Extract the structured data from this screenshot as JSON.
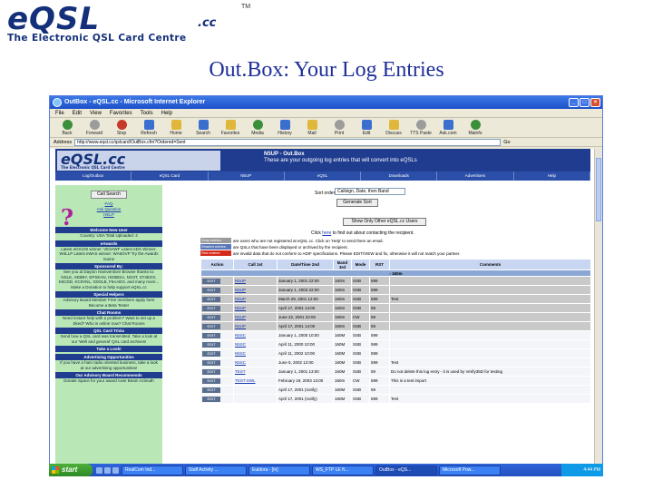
{
  "slide": {
    "logo_text": "eQSL",
    "logo_cc": ".cc",
    "logo_tm": "TM",
    "logo_subtitle": "The Electronic QSL Card Centre",
    "title": "Out.Box: Your Log Entries"
  },
  "browser": {
    "window_title": "OutBox - eQSL.cc - Microsoft Internet Explorer",
    "menu": [
      "File",
      "Edit",
      "View",
      "Favorites",
      "Tools",
      "Help"
    ],
    "toolbar": [
      "Back",
      "Forward",
      "Stop",
      "Refresh",
      "Home",
      "Search",
      "Favorites",
      "Media",
      "History",
      "Mail",
      "Print",
      "Edit",
      "Discuss",
      "TTS Paste",
      "Ask.com",
      "Mainfo"
    ],
    "address_label": "Address",
    "address": "http://www.eqsl.cc/qslcard/OutBox.cfm?Ordered=Sent",
    "go": "Go"
  },
  "site": {
    "logo": "eQSL.cc",
    "logo_sub": "The Electronic QSL Card Centre",
    "callsign": "N5UP - Out.Box",
    "subtitle": "These are your outgoing log entries that will convert into eQSLs",
    "nav": [
      "Log/Outbox",
      "eQSL Card",
      "N5UP",
      "eQSL",
      "Downloads",
      "Advertisers",
      "Help"
    ]
  },
  "sidebar": {
    "search_button": "Call Search",
    "qmark": "?",
    "faq": [
      "FAQ",
      "Ask Question",
      "HELP"
    ],
    "sections": [
      {
        "head": "Welcome New User",
        "text": "Country: USA Total Uploaded: 4"
      },
      {
        "head": "eAwards",
        "text": "Latest eDX100 winner: VE3AWF  Latest eDX Winner: W4LLP  Latest eWAS winner: WA6OVP  Try the Awards Game"
      },
      {
        "head": "Sponsored By:",
        "text": "See you at Dayton Hamvention!  Browse thanks to: NSLE, AEBBY, EPSEAN, HD0BSA, NO3T, ST4EGS, K5CDD, KC0VNL, G0OLB, F6AAEO, and many more...  Make a Donation to help support eQSL.cc"
      },
      {
        "head": "Special Helpers",
        "text": "Advisory Board Member  Free members apply here  Become a Beta Tester"
      },
      {
        "head": "Chat Rooms",
        "text": "Need instant help with a problem? Want to set up a Sked?  Who is online now?  Chat Rooms"
      },
      {
        "head": "QSL Card Trivia",
        "text": "Send how a QSL card was transmitted. Take a look at our 'Well and general' QSL card archives!"
      },
      {
        "head": "Take a Look!",
        "text": ""
      },
      {
        "head": "Advertising Opportunities",
        "text": "If you have a ham radio oriented business, take a look at our advertising opportunities!"
      },
      {
        "head": "Our Advisory Board Recommends",
        "text": "Donate Space for your award now!  Beam Azimuth"
      }
    ]
  },
  "main": {
    "sort_label": "Sort order:",
    "sort_value": "Callsign, Date, then Band",
    "generate_button": "Generate Sort",
    "show_button": "Show Only Other eQSL.cc Users",
    "click_text_pre": "Click ",
    "click_link": "here",
    "click_text_post": " to find out about contacting the recipient.",
    "legend": [
      {
        "label": "Gray entries",
        "color": "#9a9a9a",
        "text": "are users who are not registered at eQSL.cc. Click on 'Help' to send them an email."
      },
      {
        "label": "Shaded entries",
        "color": "#5a78b8",
        "text": "are QSLs that have been displayed or archived by the recipient."
      },
      {
        "label": "Red entries",
        "color": "#d42a1a",
        "text": "are invalid data that do not conform to ADIF specifications. Please EDIT/VIEW and fix, otherwise it will not match your partner."
      }
    ],
    "table_headers": [
      "Action",
      "Call 1st",
      "Date/Time 2nd",
      "Band 3rd",
      "Mode",
      "RST",
      "Comments"
    ],
    "band_label": "- 160m",
    "edit_label": "EDIT",
    "rows": [
      {
        "call": "N5UP",
        "date": "January 1, 2001 22:00",
        "band": "160m",
        "mode": "SSB",
        "rst": "599",
        "comment": "",
        "shade": "shaded"
      },
      {
        "call": "N5UP",
        "date": "January 1, 2003 22:00",
        "band": "160m",
        "mode": "SSB",
        "rst": "599",
        "comment": "",
        "shade": "shaded"
      },
      {
        "call": "N5UP",
        "date": "March 29, 2001 12:00",
        "band": "160m",
        "mode": "SSB",
        "rst": "599",
        "comment": "Test",
        "shade": "shaded"
      },
      {
        "call": "N5UP",
        "date": "April 17, 2001 14:00",
        "band": "160m",
        "mode": "SSB",
        "rst": "59",
        "comment": "",
        "shade": "shaded"
      },
      {
        "call": "N5UP",
        "date": "June 22, 2001 22:00",
        "band": "160m",
        "mode": "CW",
        "rst": "59",
        "comment": "",
        "shade": "shaded"
      },
      {
        "call": "N5UP",
        "date": "April 17, 2001 14:00",
        "band": "160m",
        "mode": "SSB",
        "rst": "59",
        "comment": "",
        "shade": "shaded"
      },
      {
        "call": "N5SC",
        "date": "January 1, 2000 10:00",
        "band": "160M",
        "mode": "SSB",
        "rst": "599",
        "comment": "",
        "shade": "plain"
      },
      {
        "call": "N5SC",
        "date": "April 11, 2000 10:00",
        "band": "160M",
        "mode": "SSB",
        "rst": "599",
        "comment": "",
        "shade": "plain"
      },
      {
        "call": "N5SC",
        "date": "April 11, 2002 10:00",
        "band": "160M",
        "mode": "SSB",
        "rst": "599",
        "comment": "",
        "shade": "plain"
      },
      {
        "call": "N5SC",
        "date": "June 5, 2002 12:00",
        "band": "160M",
        "mode": "SSB",
        "rst": "599",
        "comment": "Test",
        "shade": "plain"
      },
      {
        "call": "TEST",
        "date": "January 1, 2001 13:00",
        "band": "160M",
        "mode": "SSB",
        "rst": "59",
        "comment": "Do not delete this log entry - it is used by Verify35D for testing",
        "shade": "plain"
      },
      {
        "call": "TEST-SWL",
        "date": "February 19, 2003 13:00",
        "band": "160m",
        "mode": "CW",
        "rst": "599",
        "comment": "This is a test import",
        "shade": "plain"
      },
      {
        "call": "",
        "date": "April 17, 2001 (notify)",
        "band": "160M",
        "mode": "SSB",
        "rst": "59",
        "comment": "",
        "shade": "plain"
      },
      {
        "call": "",
        "date": "April 17, 2001 (notify)",
        "band": "160M",
        "mode": "SSB",
        "rst": "599",
        "comment": "Test",
        "shade": "plain"
      }
    ]
  },
  "taskbar": {
    "start": "start",
    "tasks": [
      "RealCom Ind...",
      "Staff Activity ...",
      "Euldora - [In]",
      "WS_FTP LE ft...",
      "OutBox - eQS...",
      "Microsoft Pow..."
    ],
    "active_index": 4,
    "clock": "4:44 PM"
  }
}
